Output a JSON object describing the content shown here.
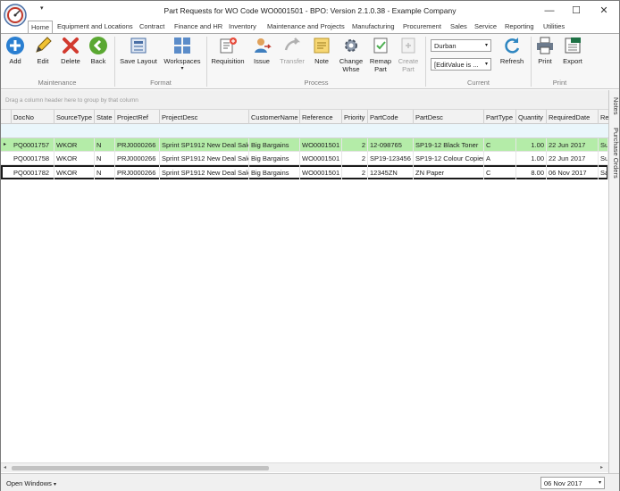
{
  "window": {
    "title": "Part Requests for WO Code WO0001501 - BPO: Version 2.1.0.38 - Example Company",
    "qat_arrow": "▾",
    "minimize": "—",
    "maximize": "☐",
    "close": "✕"
  },
  "tabs": [
    "Home",
    "Equipment and Locations",
    "Contract",
    "Finance and HR",
    "Inventory",
    "Maintenance and Projects",
    "Manufacturing",
    "Procurement",
    "Sales",
    "Service",
    "Reporting",
    "Utilities"
  ],
  "ribbon": {
    "maintenance": {
      "label": "Maintenance",
      "add": "Add",
      "edit": "Edit",
      "delete": "Delete",
      "back": "Back"
    },
    "format": {
      "label": "Format",
      "save_layout": "Save Layout",
      "workspaces": "Workspaces",
      "workspaces_arrow": "▾"
    },
    "process": {
      "label": "Process",
      "requisition": "Requisition",
      "issue": "Issue",
      "transfer": "Transfer",
      "note": "Note",
      "change_whse": "Change\nWhse",
      "change_whse_l1": "Change",
      "change_whse_l2": "Whse",
      "remap_l1": "Remap",
      "remap_l2": "Part",
      "create_l1": "Create",
      "create_l2": "Part"
    },
    "current": {
      "label": "Current",
      "warehouse": "Durban",
      "edit_value": "[EditValue is ...",
      "refresh": "Refresh"
    },
    "print": {
      "label": "Print",
      "print": "Print",
      "export": "Export"
    }
  },
  "group_panel_hint": "Drag a column header here to group by that column",
  "columns": [
    "DocNo",
    "SourceType",
    "State",
    "ProjectRef",
    "ProjectDesc",
    "CustomerName",
    "Reference",
    "Priority",
    "PartCode",
    "PartDesc",
    "PartType",
    "Quantity",
    "RequiredDate",
    "Re"
  ],
  "row_indicator": "▸",
  "rows": [
    {
      "DocNo": "PQ0001757",
      "SourceType": "WKOR",
      "State": "N",
      "ProjectRef": "PRJ0000266",
      "ProjectDesc": "Sprint SP1912 New Deal Sale",
      "CustomerName": "Big Bargains",
      "Reference": "WO0001501",
      "Priority": "2",
      "PartCode": "12-098765",
      "PartDesc": "SP19-12 Black Toner",
      "PartType": "C",
      "Quantity": "1.00",
      "RequiredDate": "22 Jun 2017",
      "Re": "Su"
    },
    {
      "DocNo": "PQ0001758",
      "SourceType": "WKOR",
      "State": "N",
      "ProjectRef": "PRJ0000266",
      "ProjectDesc": "Sprint SP1912 New Deal Sale",
      "CustomerName": "Big Bargains",
      "Reference": "WO0001501",
      "Priority": "2",
      "PartCode": "SP19-123456",
      "PartDesc": "SP19-12 Colour Copier",
      "PartType": "A",
      "Quantity": "1.00",
      "RequiredDate": "22 Jun 2017",
      "Re": "Su"
    },
    {
      "DocNo": "PQ0001782",
      "SourceType": "WKOR",
      "State": "N",
      "ProjectRef": "PRJ0000266",
      "ProjectDesc": "Sprint SP1912 New Deal Sale",
      "CustomerName": "Big Bargains",
      "Reference": "WO0001501",
      "Priority": "2",
      "PartCode": "12345ZN",
      "PartDesc": "ZN Paper",
      "PartType": "C",
      "Quantity": "8.00",
      "RequiredDate": "06 Nov 2017",
      "Re": "Sa"
    }
  ],
  "side_tabs": {
    "notes": "Notes",
    "purchase_orders": "Purchase Orders"
  },
  "statusbar": {
    "open_windows": "Open Windows",
    "open_windows_arrow": "▾",
    "date": "06 Nov 2017",
    "date_arrow": "▾"
  },
  "colors": {
    "accent_green_row": "#b4eca8",
    "filter_row": "#eaf6fb",
    "add_blue": "#2a7fd1",
    "delete_red": "#d23a2f",
    "back_green": "#5aa832"
  }
}
